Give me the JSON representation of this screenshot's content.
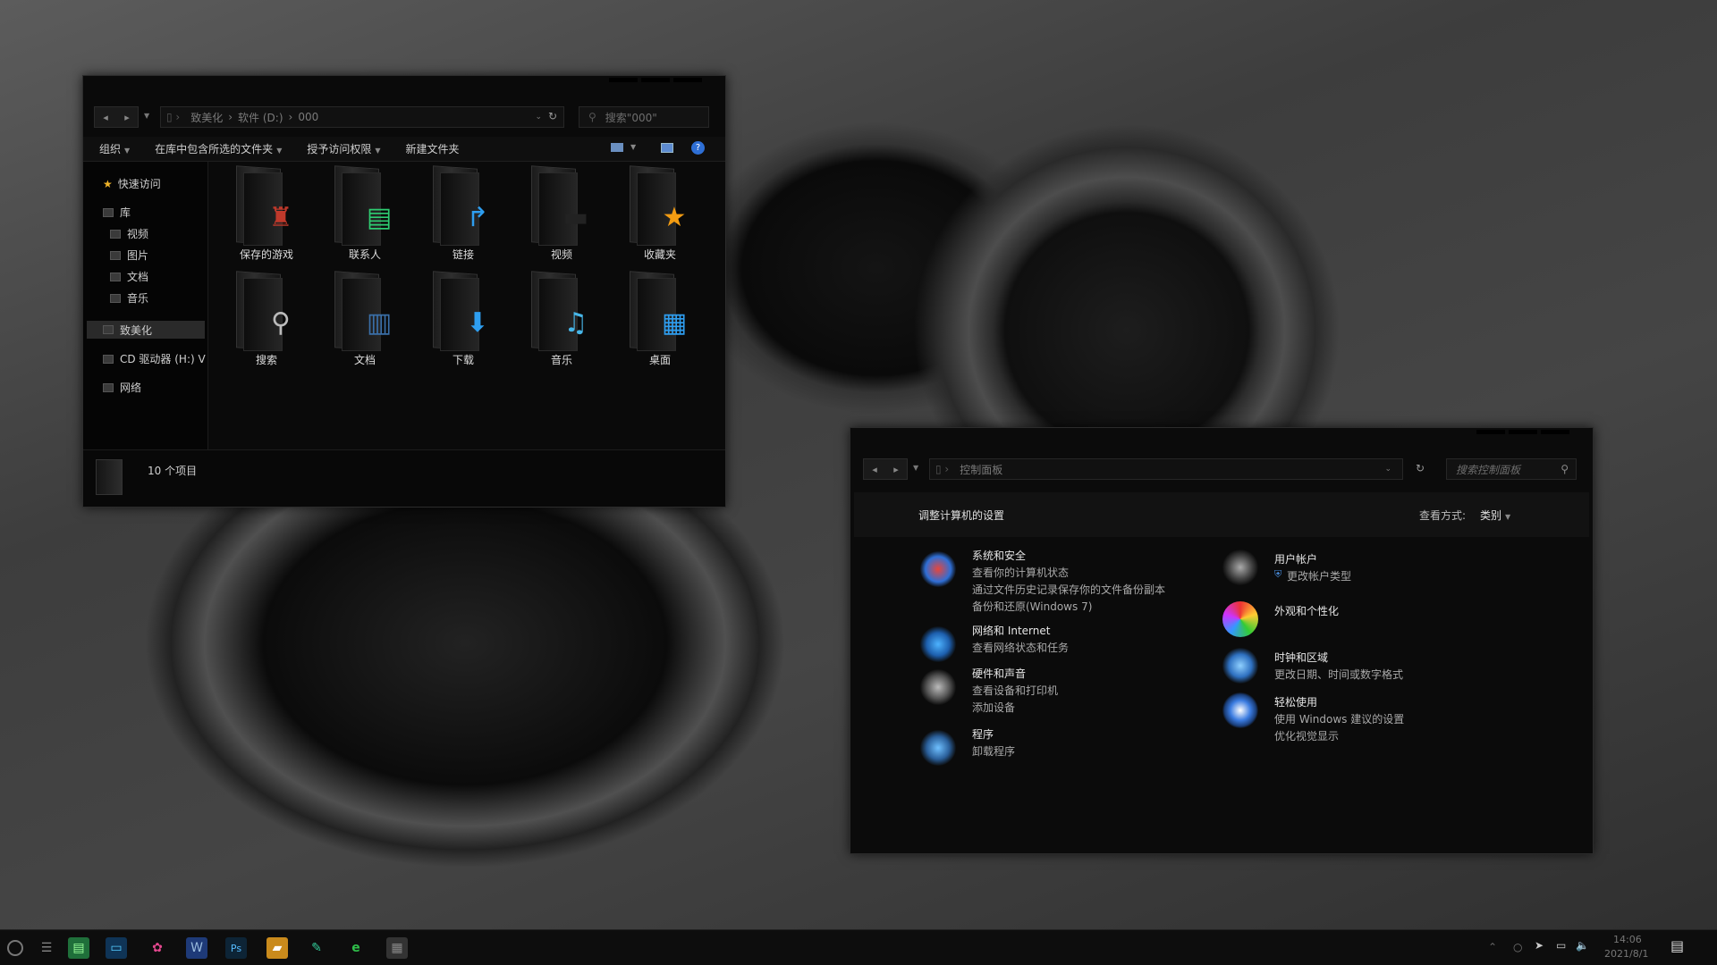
{
  "explorer": {
    "address": [
      "致美化",
      "软件 (D:)",
      "000"
    ],
    "search_placeholder": "搜索\"000\"",
    "toolbar": {
      "organize": "组织",
      "include": "在库中包含所选的文件夹",
      "share": "授予访问权限",
      "new_folder": "新建文件夹"
    },
    "nav": {
      "quick": "快速访问",
      "library": "库",
      "video": "视频",
      "pictures": "图片",
      "docs": "文档",
      "music": "音乐",
      "zhimeihua": "致美化",
      "cd": "CD 驱动器 (H:) V",
      "network": "网络"
    },
    "folders": [
      {
        "label": "保存的游戏",
        "icon": "♜",
        "color": "#c0392b"
      },
      {
        "label": "联系人",
        "icon": "▤",
        "color": "#2ecc71"
      },
      {
        "label": "链接",
        "icon": "↱",
        "color": "#2e9ef0"
      },
      {
        "label": "视频",
        "icon": "▬",
        "color": "#222222"
      },
      {
        "label": "收藏夹",
        "icon": "★",
        "color": "#f39c12"
      },
      {
        "label": "搜索",
        "icon": "⚲",
        "color": "#bbbbbb"
      },
      {
        "label": "文档",
        "icon": "▥",
        "color": "#3a6fa8"
      },
      {
        "label": "下载",
        "icon": "⬇",
        "color": "#2e9ef0"
      },
      {
        "label": "音乐",
        "icon": "♫",
        "color": "#47b6e8"
      },
      {
        "label": "桌面",
        "icon": "▦",
        "color": "#2e9ef0"
      }
    ],
    "status": "10 个项目"
  },
  "control_panel": {
    "address": "控制面板",
    "search_placeholder": "搜索控制面板",
    "heading": "调整计算机的设置",
    "view_by_label": "查看方式:",
    "view_by_value": "类别",
    "left": [
      {
        "title": "系统和安全",
        "links": [
          "查看你的计算机状态",
          "通过文件历史记录保存你的文件备份副本",
          "备份和还原(Windows 7)"
        ],
        "icon": "shield-icon"
      },
      {
        "title": "网络和 Internet",
        "links": [
          "查看网络状态和任务"
        ],
        "icon": "network-icon"
      },
      {
        "title": "硬件和声音",
        "links": [
          "查看设备和打印机",
          "添加设备"
        ],
        "icon": "hardware-icon"
      },
      {
        "title": "程序",
        "links": [
          "卸载程序"
        ],
        "icon": "programs-icon"
      }
    ],
    "right": [
      {
        "title": "用户帐户",
        "links": [
          "更改帐户类型"
        ],
        "icon": "users-icon"
      },
      {
        "title": "外观和个性化",
        "links": [],
        "icon": "appearance-icon"
      },
      {
        "title": "时钟和区域",
        "links": [
          "更改日期、时间或数字格式"
        ],
        "icon": "clock-globe-icon"
      },
      {
        "title": "轻松使用",
        "links": [
          "使用 Windows 建议的设置",
          "优化视觉显示"
        ],
        "icon": "accessibility-icon"
      }
    ]
  },
  "taskbar": {
    "time": "14:06",
    "date": "2021/8/1"
  },
  "colors": {
    "accent": "#2e9ef0",
    "window_bg": "#0a0a0a"
  }
}
